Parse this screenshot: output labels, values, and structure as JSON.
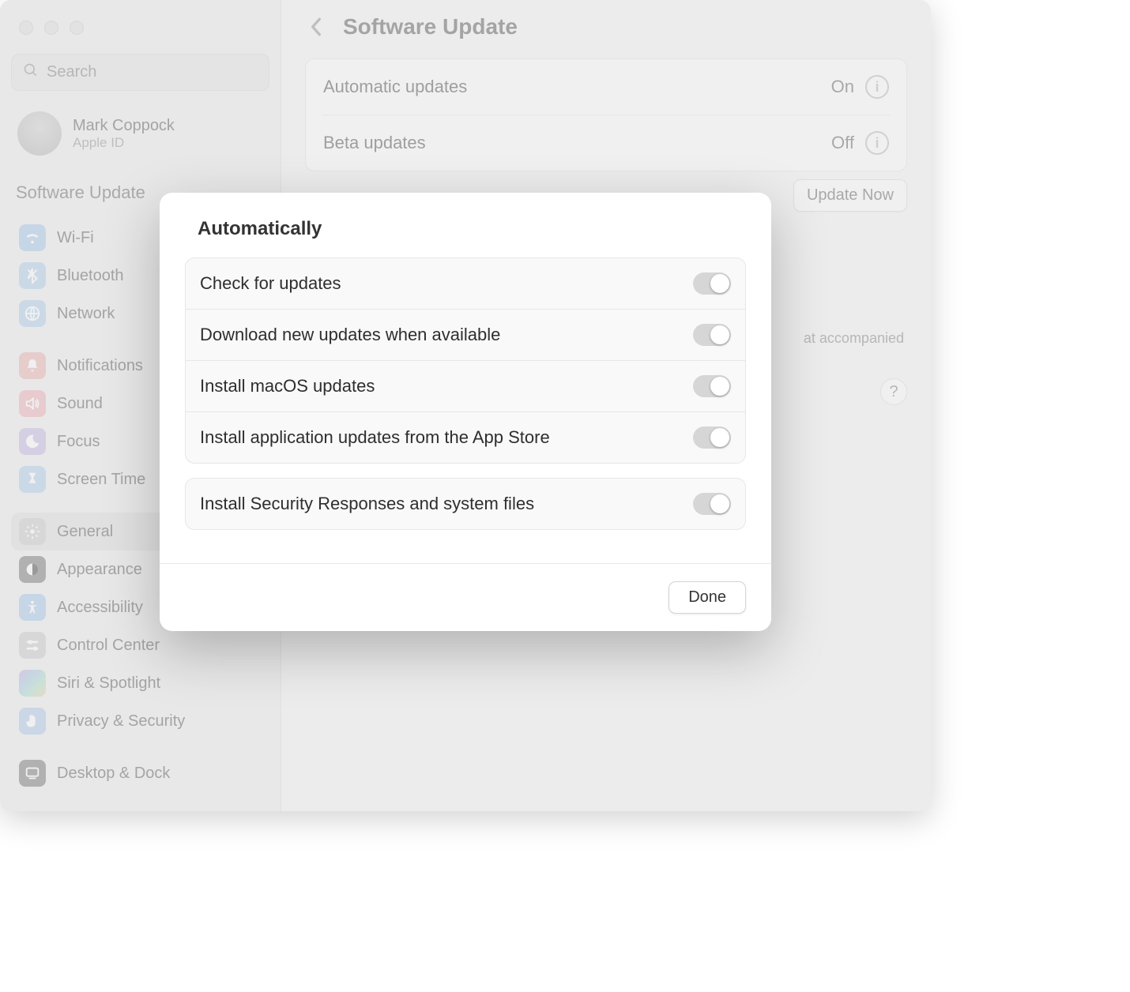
{
  "search": {
    "placeholder": "Search"
  },
  "account": {
    "name": "Mark Coppock",
    "sub": "Apple ID"
  },
  "sidebar": {
    "current": "Software Update",
    "items": [
      {
        "label": "Wi-Fi"
      },
      {
        "label": "Bluetooth"
      },
      {
        "label": "Network"
      },
      {
        "label": "Notifications"
      },
      {
        "label": "Sound"
      },
      {
        "label": "Focus"
      },
      {
        "label": "Screen Time"
      },
      {
        "label": "General"
      },
      {
        "label": "Appearance"
      },
      {
        "label": "Accessibility"
      },
      {
        "label": "Control Center"
      },
      {
        "label": "Siri & Spotlight"
      },
      {
        "label": "Privacy & Security"
      },
      {
        "label": "Desktop & Dock"
      }
    ]
  },
  "page": {
    "title": "Software Update",
    "rows": {
      "auto": {
        "label": "Automatic updates",
        "value": "On"
      },
      "beta": {
        "label": "Beta updates",
        "value": "Off"
      }
    },
    "update_now": "Update Now",
    "agreement_fragment": "at accompanied",
    "help": "?"
  },
  "modal": {
    "title": "Automatically",
    "items": [
      {
        "label": "Check for updates",
        "on": true
      },
      {
        "label": "Download new updates when available",
        "on": true
      },
      {
        "label": "Install macOS updates",
        "on": true
      },
      {
        "label": "Install application updates from the App Store",
        "on": true
      }
    ],
    "security": {
      "label": "Install Security Responses and system files",
      "on": true
    },
    "done": "Done"
  }
}
